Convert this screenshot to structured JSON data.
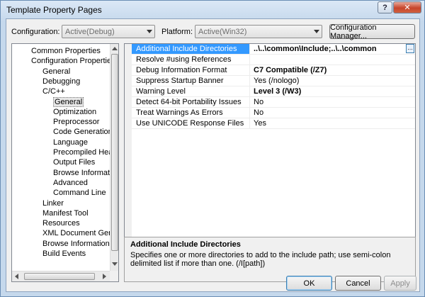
{
  "window": {
    "title": "Template Property Pages",
    "help_label": "?",
    "close_label": "✕"
  },
  "toolbar": {
    "configuration_label": "Configuration:",
    "configuration_value": "Active(Debug)",
    "platform_label": "Platform:",
    "platform_value": "Active(Win32)",
    "config_manager_label": "Configuration Manager..."
  },
  "tree": {
    "items": [
      {
        "label": "Common Properties",
        "indent": 0
      },
      {
        "label": "Configuration Properties",
        "indent": 0
      },
      {
        "label": "General",
        "indent": 1
      },
      {
        "label": "Debugging",
        "indent": 1
      },
      {
        "label": "C/C++",
        "indent": 1
      },
      {
        "label": "General",
        "indent": 2,
        "selected": true
      },
      {
        "label": "Optimization",
        "indent": 2
      },
      {
        "label": "Preprocessor",
        "indent": 2
      },
      {
        "label": "Code Generation",
        "indent": 2
      },
      {
        "label": "Language",
        "indent": 2
      },
      {
        "label": "Precompiled Heade",
        "indent": 2
      },
      {
        "label": "Output Files",
        "indent": 2
      },
      {
        "label": "Browse Information",
        "indent": 2
      },
      {
        "label": "Advanced",
        "indent": 2
      },
      {
        "label": "Command Line",
        "indent": 2
      },
      {
        "label": "Linker",
        "indent": 1
      },
      {
        "label": "Manifest Tool",
        "indent": 1
      },
      {
        "label": "Resources",
        "indent": 1
      },
      {
        "label": "XML Document Genera",
        "indent": 1
      },
      {
        "label": "Browse Information",
        "indent": 1
      },
      {
        "label": "Build Events",
        "indent": 1
      }
    ]
  },
  "properties": {
    "rows": [
      {
        "name": "Additional Include Directories",
        "value": "..\\..\\common\\Include;..\\..\\common",
        "bold": true,
        "selected": true
      },
      {
        "name": "Resolve #using References",
        "value": "",
        "bold": false
      },
      {
        "name": "Debug Information Format",
        "value": "C7 Compatible (/Z7)",
        "bold": true
      },
      {
        "name": "Suppress Startup Banner",
        "value": "Yes (/nologo)",
        "bold": false
      },
      {
        "name": "Warning Level",
        "value": "Level 3 (/W3)",
        "bold": true
      },
      {
        "name": "Detect 64-bit Portability Issues",
        "value": "No",
        "bold": false
      },
      {
        "name": "Treat Warnings As Errors",
        "value": "No",
        "bold": false
      },
      {
        "name": "Use UNICODE Response Files",
        "value": "Yes",
        "bold": false
      }
    ],
    "ellipsis_label": "..."
  },
  "description": {
    "title": "Additional Include Directories",
    "text": "Specifies one or more directories to add to the include path; use semi-colon delimited list if more than one.     (/I[path])"
  },
  "buttons": {
    "ok": "OK",
    "cancel": "Cancel",
    "apply": "Apply"
  }
}
